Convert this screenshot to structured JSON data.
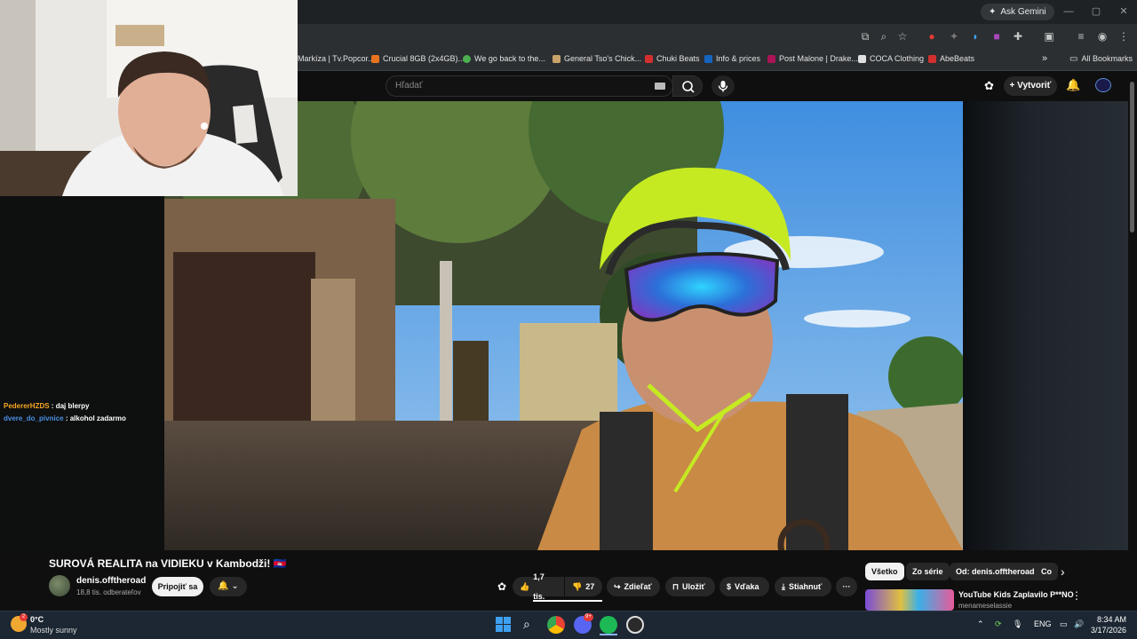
{
  "browser": {
    "gemini_label": "Ask Gemini",
    "window_controls": [
      "—",
      "▢",
      "✕"
    ],
    "bookmarks": [
      {
        "label": "Markíza | Tv.Popcor...",
        "color": "#e0e0e0"
      },
      {
        "label": "Crucial 8GB (2x4GB)...",
        "color": "#e8731e"
      },
      {
        "label": "We go back to the...",
        "color": "#4caf50"
      },
      {
        "label": "General Tso's Chick...",
        "color": "#c9a36a"
      },
      {
        "label": "Chuki Beats",
        "color": "#d32f2f"
      },
      {
        "label": "Info & prices",
        "color": "#1565c0"
      },
      {
        "label": "Post Malone | Drake...",
        "color": "#ad1457"
      },
      {
        "label": "COCA Clothing",
        "color": "#212121"
      },
      {
        "label": "AbeBeats",
        "color": "#d32f2f"
      }
    ],
    "more_bookmarks": "»",
    "all_bookmarks": "All Bookmarks"
  },
  "youtube": {
    "search_placeholder": "Hľadať",
    "create_label": "Vytvoriť",
    "video_title": "SUROVÁ REALITA na VIDIEKU v Kambodži! 🇰🇭",
    "title_flag": "KH",
    "channel_name": "denis.offtheroad",
    "subscribers": "18,8 tis. odberateľov",
    "join_label": "Pripojiť sa",
    "likes": "1,7 tis.",
    "dislikes": "27",
    "share": "Zdieľať",
    "save": "Uložiť",
    "thanks": "Vďaka",
    "download": "Stiahnuť",
    "more": "···",
    "chips": [
      "Všetko",
      "Zo série",
      "Od: denis.offtheroad",
      "Co"
    ],
    "recommendation_title": "YouTube Kids Zaplavilo P**NO",
    "recommendation_channel": "menameselassie"
  },
  "chat": [
    {
      "user": "PedererHZDS",
      "message": "daj blerpy",
      "color": "#f5a623"
    },
    {
      "user": "dvere_do_pivnice",
      "message": "alkohol zadarmo",
      "color": "#4a90e2"
    }
  ],
  "taskbar": {
    "temperature": "0°C",
    "weather": "Mostly sunny",
    "weather_badge": "2",
    "discord_badge": "9+",
    "language": "ENG",
    "time": "8:34 AM",
    "date": "3/17/2026"
  }
}
